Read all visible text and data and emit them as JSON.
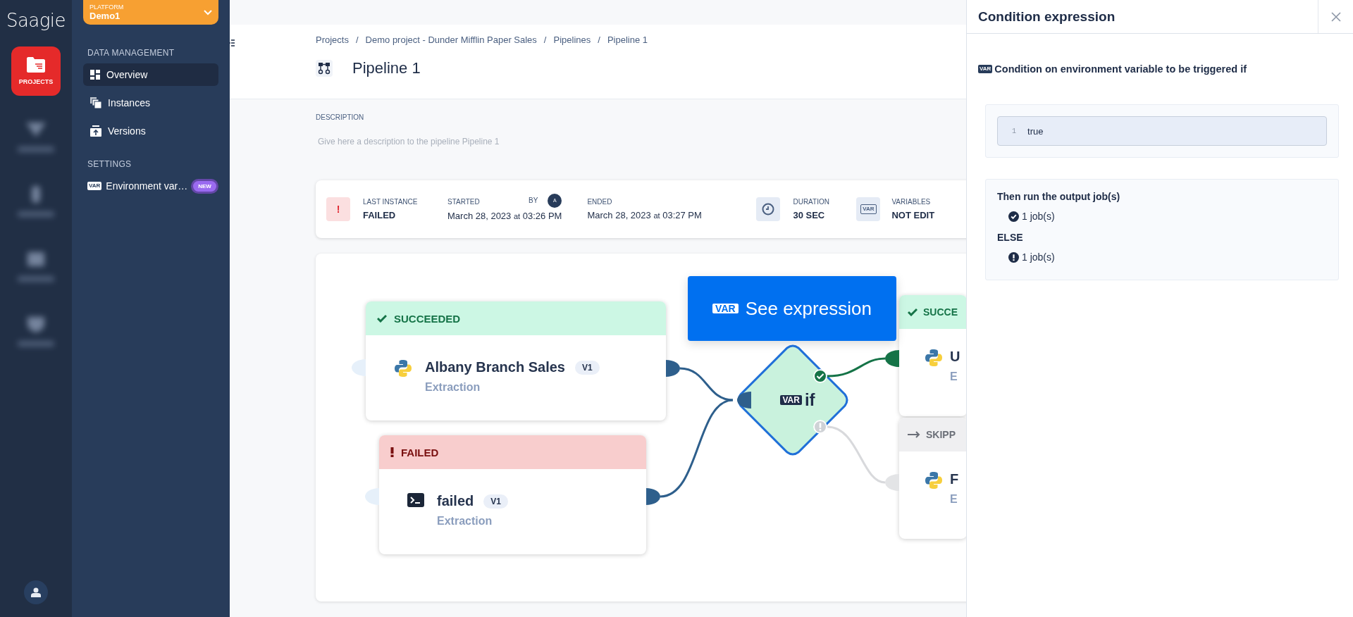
{
  "rail": {
    "logo": "Saagie",
    "items": [
      {
        "label": "PROJECTS",
        "selected": true
      },
      {
        "selected": false
      },
      {
        "selected": false
      },
      {
        "selected": false
      },
      {
        "selected": false
      }
    ]
  },
  "platform": {
    "label": "PLATFORM",
    "name": "Demo1"
  },
  "nav": {
    "sections": [
      {
        "heading": "DATA MANAGEMENT",
        "items": [
          {
            "label": "Overview",
            "kind": "grid",
            "selected": true
          },
          {
            "label": "Instances",
            "kind": "stack",
            "selected": false
          },
          {
            "label": "Versions",
            "kind": "upload",
            "selected": false
          }
        ]
      },
      {
        "heading": "SETTINGS",
        "items": [
          {
            "label": "Environment var…",
            "kind": "var",
            "icon_text": "VAR",
            "badge": "NEW",
            "selected": false
          }
        ]
      }
    ]
  },
  "header": {
    "breadcrumbs": [
      "Projects",
      "Demo project - Dunder Mifflin Paper Sales",
      "Pipelines",
      "Pipeline 1"
    ],
    "separator": "/",
    "title": "Pipeline 1"
  },
  "description": {
    "label": "DESCRIPTION",
    "placeholder": "Give here a description to the pipeline Pipeline 1"
  },
  "status_card": {
    "last_instance": {
      "label": "LAST INSTANCE",
      "value": "FAILED",
      "kind": "failed",
      "icon_text": "!"
    },
    "started": {
      "label": "STARTED",
      "date": "March 28, 2023",
      "at": "at",
      "time": "03:26 PM"
    },
    "by": {
      "label": "BY",
      "avatar": "A"
    },
    "ended": {
      "label": "ENDED",
      "date": "March 28, 2023",
      "at": "at",
      "time": "03:27 PM"
    },
    "duration": {
      "label": "DURATION",
      "value": "30 SEC"
    },
    "variables": {
      "label": "VARIABLES",
      "icon_text": "VAR",
      "value": "NOT EDIT"
    }
  },
  "diagram": {
    "jobs": [
      {
        "kind": "succeeded",
        "status_label": "SUCCEEDED",
        "name": "Albany Branch Sales",
        "version": "V1",
        "category": "Extraction"
      },
      {
        "kind": "failed",
        "status_label": "FAILED",
        "name": "failed",
        "version": "V1",
        "category": "Extraction"
      },
      {
        "kind": "succeeded",
        "status_label": "SUCCE",
        "name": "U",
        "category": "E"
      },
      {
        "kind": "skipped",
        "status_label": "SKIPP",
        "name": "F",
        "category": "E"
      }
    ],
    "see_expression": {
      "tag": "VAR",
      "label": "See expression"
    },
    "condition": {
      "tag": "VAR",
      "label": "if"
    }
  },
  "panel": {
    "title": "Condition expression",
    "heading_tag": "VAR",
    "heading": "Condition on environment variable to be triggered if",
    "code": {
      "line_number": "1",
      "value": "true"
    },
    "then": {
      "title": "Then run the output job(s)",
      "count": "1 job(s)"
    },
    "else": {
      "title": "ELSE",
      "count": "1 job(s)"
    }
  }
}
